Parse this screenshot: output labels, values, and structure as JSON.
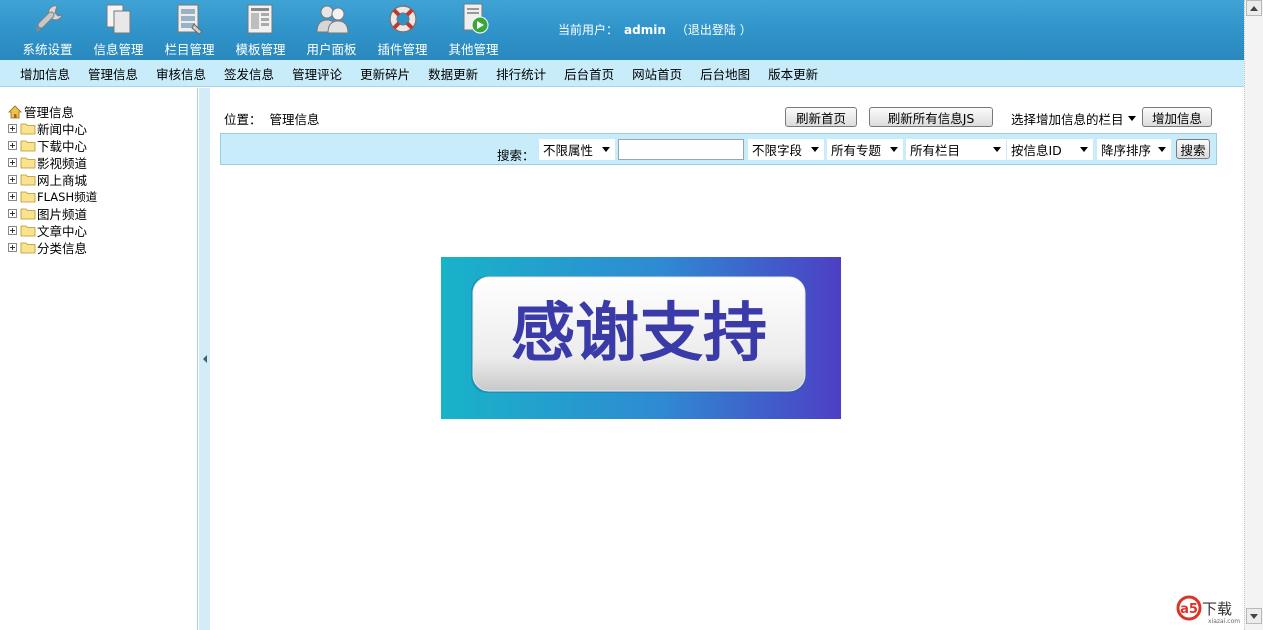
{
  "header": {
    "nav": [
      {
        "label": "系统设置",
        "icon": "wrench-icon"
      },
      {
        "label": "信息管理",
        "icon": "documents-icon"
      },
      {
        "label": "栏目管理",
        "icon": "column-icon"
      },
      {
        "label": "模板管理",
        "icon": "template-icon"
      },
      {
        "label": "用户面板",
        "icon": "users-icon"
      },
      {
        "label": "插件管理",
        "icon": "lifebuoy-icon"
      },
      {
        "label": "其他管理",
        "icon": "play-document-icon"
      }
    ],
    "current_user_label": "当前用户：",
    "username": "admin",
    "logout_label": "（退出登陆 ）"
  },
  "submenu": {
    "items": [
      "增加信息",
      "管理信息",
      "审核信息",
      "签发信息",
      "管理评论",
      "更新碎片",
      "数据更新",
      "排行统计",
      "后台首页",
      "网站首页",
      "后台地图",
      "版本更新"
    ]
  },
  "tree": {
    "root": "管理信息",
    "nodes": [
      "新闻中心",
      "下载中心",
      "影视频道",
      "网上商城",
      "FLASH频道",
      "图片频道",
      "文章中心",
      "分类信息"
    ]
  },
  "main": {
    "location_label": "位置：",
    "location_value": "管理信息",
    "refresh_home": "刷新首页",
    "refresh_all_js": "刷新所有信息JS",
    "select_column": "选择增加信息的栏目",
    "add_info": "增加信息",
    "search": {
      "label": "搜索：",
      "attr": "不限属性",
      "keyword": "",
      "field": "不限字段",
      "topic": "所有专题",
      "column": "所有栏目",
      "order_by": "按信息ID",
      "order": "降序排序",
      "button": "搜索"
    },
    "banner_text": "感谢支持"
  },
  "watermark": {
    "brand": "a5",
    "text": "下载",
    "url": "xiazai.com"
  },
  "colors": {
    "header": "#2f93c9",
    "submenu": "#c9ecfa",
    "banner_text": "#3a3aa8"
  }
}
